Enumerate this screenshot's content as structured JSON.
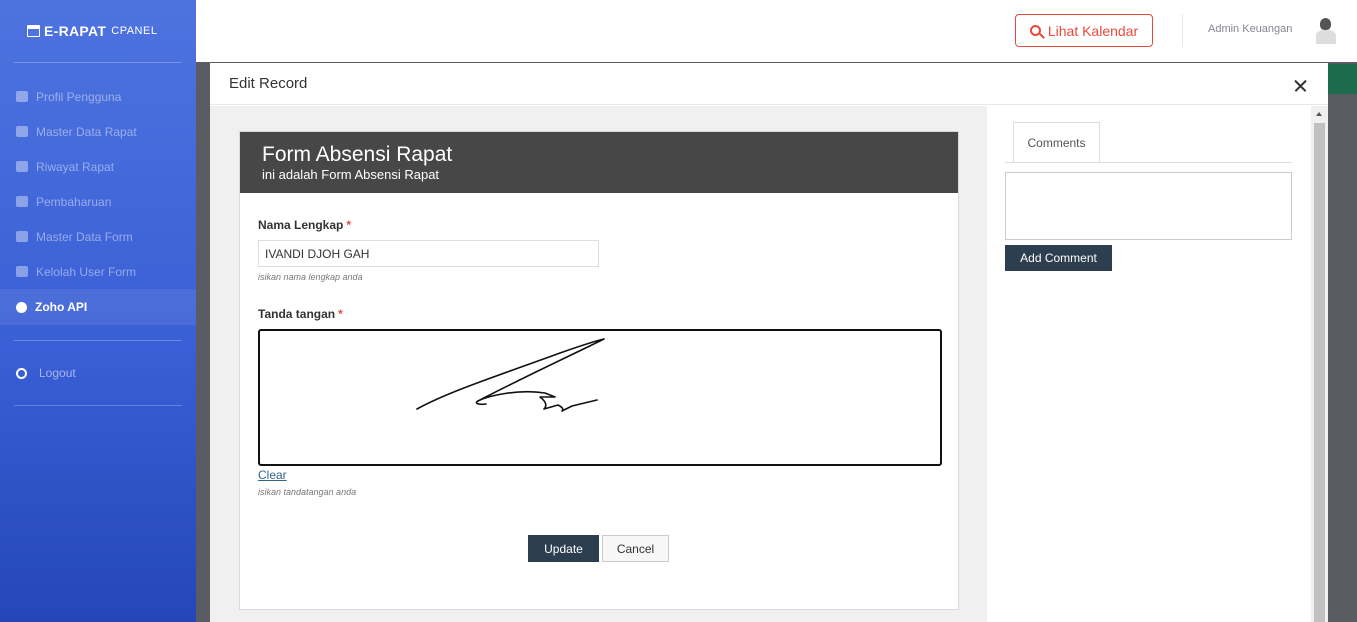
{
  "sidebar": {
    "brand": "E-RAPAT",
    "brand_sub": "CPANEL",
    "items": [
      {
        "label": "Profil Pengguna"
      },
      {
        "label": "Master Data Rapat"
      },
      {
        "label": "Riwayat Rapat"
      },
      {
        "label": "Pembaharuan"
      },
      {
        "label": "Master Data Form"
      },
      {
        "label": "Kelolah User Form"
      },
      {
        "label": "Zoho API"
      }
    ],
    "active_item": "Zoho API",
    "logout": "Logout"
  },
  "topbar": {
    "calendar_button": "Lihat Kalendar",
    "user_name": "Admin Keuangan"
  },
  "modal": {
    "title": "Edit Record",
    "form": {
      "title": "Form Absensi Rapat",
      "subtitle": "ini adalah Form Absensi Rapat",
      "name_label": "Nama Lengkap",
      "required_mark": "*",
      "name_value": "IVANDI DJOH GAH",
      "name_hint": "isikan nama lengkap anda",
      "signature_label": "Tanda tangan",
      "clear_link": "Clear",
      "signature_hint": "isikan tandatangan anda",
      "update_button": "Update",
      "cancel_button": "Cancel"
    },
    "comments": {
      "tab_label": "Comments",
      "add_button": "Add Comment"
    }
  },
  "colors": {
    "sidebar_top": "#4e73df",
    "sidebar_bottom": "#2446b8",
    "danger": "#e74a3b",
    "dark_button": "#2c3e50",
    "form_header": "#474747"
  }
}
